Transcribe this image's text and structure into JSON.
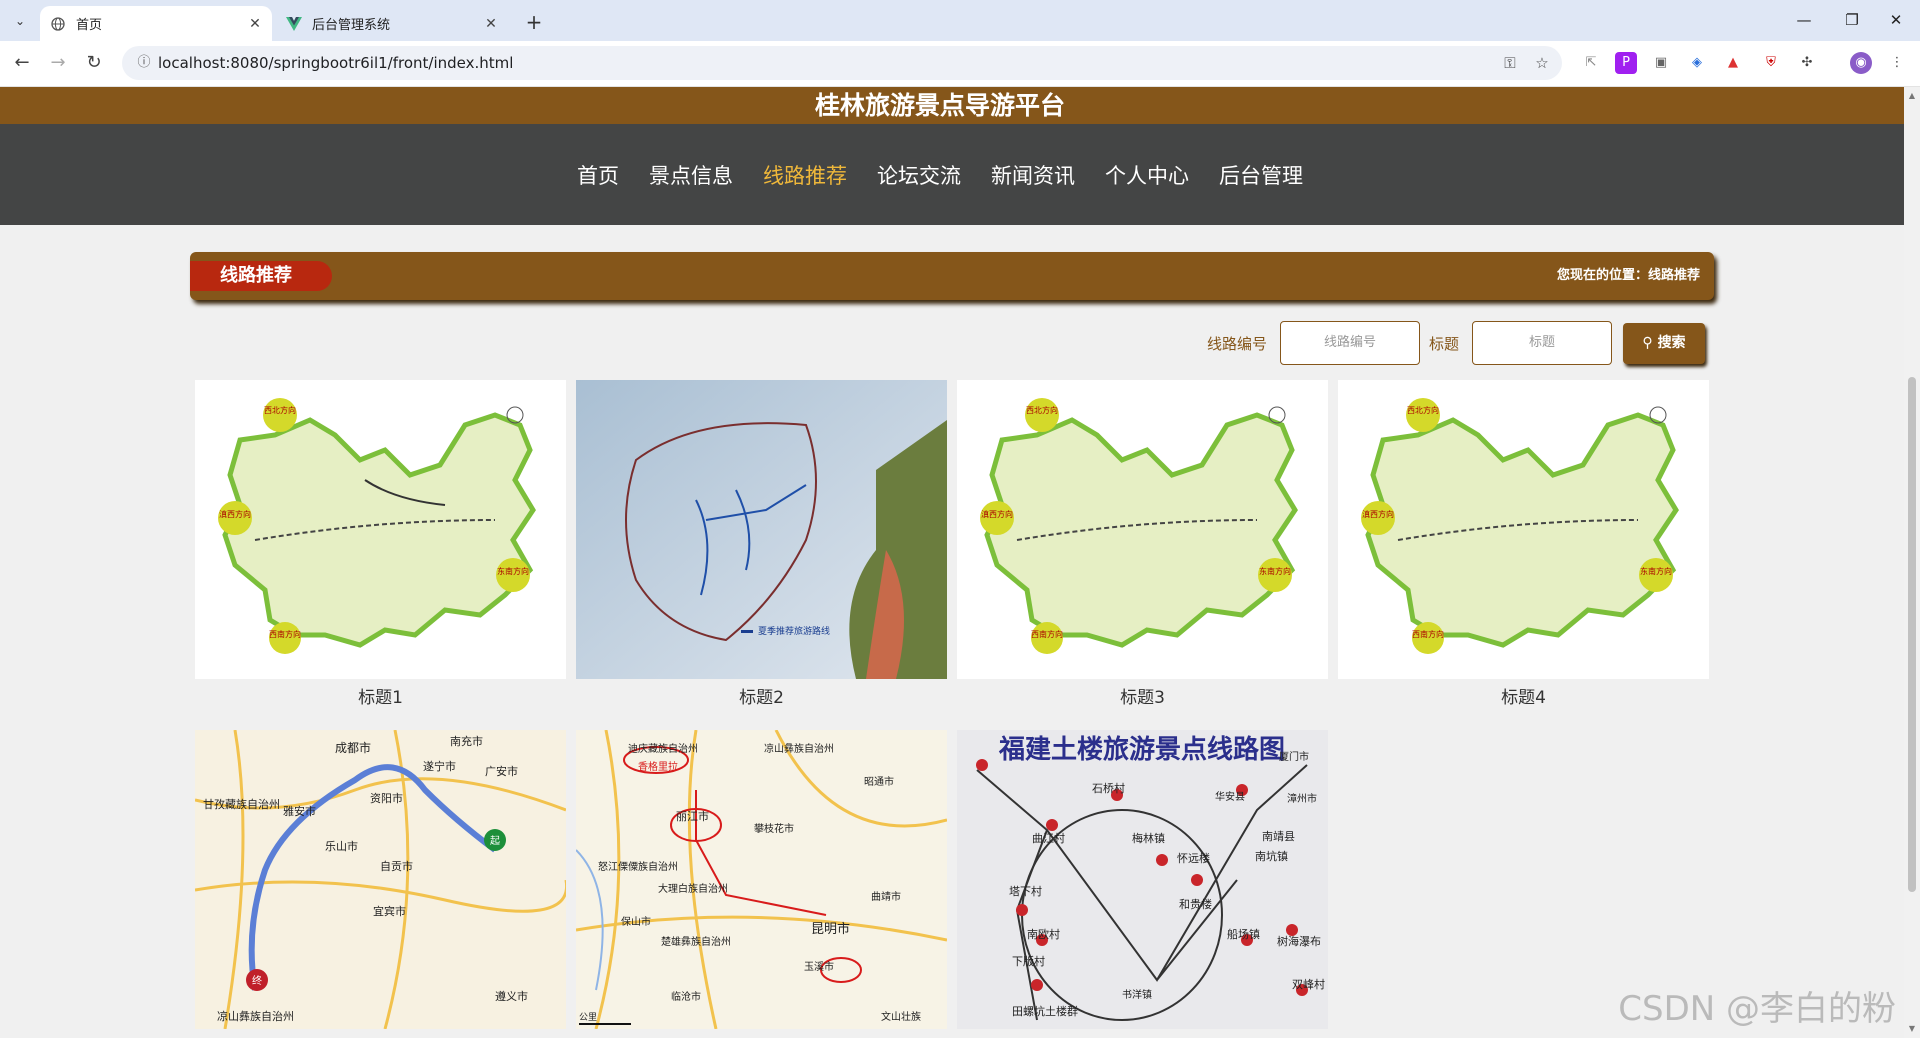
{
  "browser": {
    "tabs": [
      {
        "title": "首页",
        "icon": "globe-icon"
      },
      {
        "title": "后台管理系统",
        "icon": "vue-logo-icon"
      }
    ],
    "url": "localhost:8080/springbootr6il1/front/index.html"
  },
  "site": {
    "title": "桂林旅游景点导游平台",
    "nav": [
      "首页",
      "景点信息",
      "线路推荐",
      "论坛交流",
      "新闻资讯",
      "个人中心",
      "后台管理"
    ],
    "active_nav": "线路推荐"
  },
  "section": {
    "heading": "线路推荐",
    "location": "您现在的位置：线路推荐"
  },
  "search": {
    "code_label": "线路编号",
    "code_placeholder": "线路编号",
    "title_label": "标题",
    "title_placeholder": "标题",
    "button_label": "搜索"
  },
  "cards": [
    {
      "caption": "标题1",
      "image": "yunnan-region-map"
    },
    {
      "caption": "标题2",
      "image": "scenic-area-route-map"
    },
    {
      "caption": "标题3",
      "image": "yunnan-region-map"
    },
    {
      "caption": "标题4",
      "image": "yunnan-region-map"
    },
    {
      "caption": "",
      "image": "sichuan-road-map"
    },
    {
      "caption": "",
      "image": "yunnan-road-map"
    },
    {
      "caption": "",
      "image": "fujian-tulou-route-map",
      "image_title": "福建土楼旅游景点线路图"
    }
  ],
  "map_labels": {
    "region": [
      "西北方向",
      "滇西方向",
      "东南方向",
      "西南方向"
    ],
    "scenic_legend": "夏季推荐旅游路线",
    "sichuan": [
      "成都市",
      "南充市",
      "甘孜藏族自治州",
      "雅安市",
      "资阳市",
      "遂宁市",
      "广安市",
      "乐山市",
      "自贡市",
      "宜宾市",
      "凉山彝族自治州",
      "遵义市",
      "起",
      "终"
    ],
    "yunnan": [
      "迪庆藏族自治州",
      "香格里拉",
      "丽江市",
      "怒江傈僳族自治州",
      "大理白族自治州",
      "凉山彝族自治州",
      "攀枝花市",
      "昭通市",
      "曲靖市",
      "昆明市",
      "保山市",
      "楚雄彝族自治州",
      "玉溪市",
      "临沧市",
      "文山壮族",
      "公里"
    ],
    "fujian": [
      "石桥村",
      "曲江村",
      "塔下村",
      "南欧村",
      "下版村",
      "田螺坑土楼群",
      "书洋镇",
      "梅林镇",
      "怀远楼",
      "和贵楼",
      "船场镇",
      "华安县",
      "南靖县",
      "南坑镇",
      "树海瀑布",
      "双峰村",
      "厦门市",
      "漳州市"
    ]
  },
  "watermark": "CSDN @李白的粉"
}
